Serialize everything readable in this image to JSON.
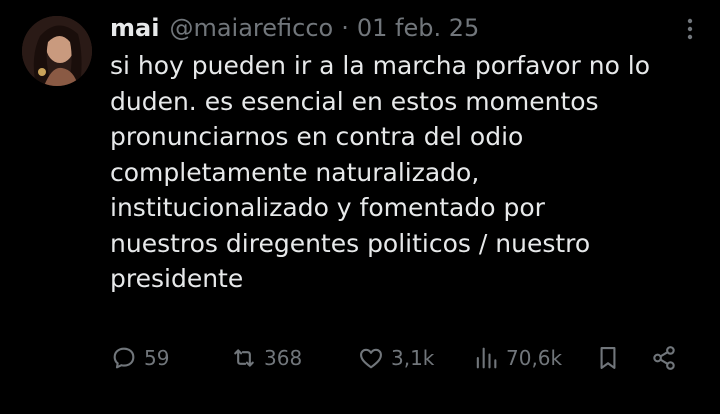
{
  "tweet": {
    "author": {
      "display_name": "mai",
      "handle": "@maiareficco",
      "separator": "·",
      "date": "01 feb. 25"
    },
    "text_lines": [
      "si hoy pueden ir a la marcha porfavor no lo",
      "duden. es esencial en estos momentos",
      "pronunciarnos en contra del odio",
      "completamente naturalizado,",
      "institucionalizado y fomentado por",
      "nuestros diregentes politicos / nuestro",
      "presidente"
    ],
    "actions": {
      "reply": {
        "icon": "reply-icon",
        "count": "59"
      },
      "repost": {
        "icon": "repost-icon",
        "count": "368"
      },
      "like": {
        "icon": "heart-icon",
        "count": "3,1k"
      },
      "views": {
        "icon": "views-icon",
        "count": "70,6k"
      },
      "bookmark": {
        "icon": "bookmark-icon"
      },
      "share": {
        "icon": "share-icon"
      }
    }
  },
  "colors": {
    "background": "#000000",
    "primary_text": "#e7e9ea",
    "secondary_text": "#71767b"
  }
}
